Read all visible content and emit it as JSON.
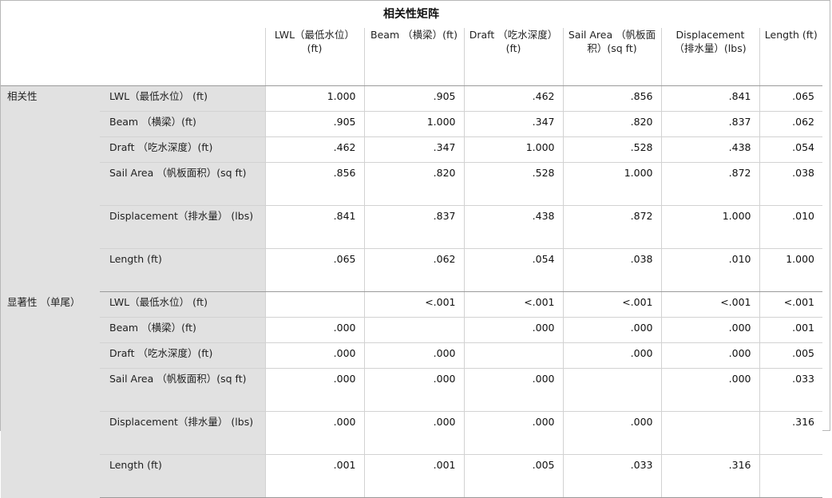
{
  "title": "相关性矩阵",
  "columns": [
    "LWL（最低水位）(ft)",
    "Beam （横梁）(ft)",
    "Draft （吃水深度）(ft)",
    "Sail Area （帆板面积）(sq ft)",
    "Displacement（排水量）(lbs)",
    "Length (ft)"
  ],
  "sections": [
    {
      "label": "相关性",
      "rows": [
        {
          "label": "LWL（最低水位） (ft)",
          "values": [
            "1.000",
            ".905",
            ".462",
            ".856",
            ".841",
            ".065"
          ]
        },
        {
          "label": "Beam （横梁）(ft)",
          "values": [
            ".905",
            "1.000",
            ".347",
            ".820",
            ".837",
            ".062"
          ]
        },
        {
          "label": "Draft （吃水深度）(ft)",
          "values": [
            ".462",
            ".347",
            "1.000",
            ".528",
            ".438",
            ".054"
          ]
        },
        {
          "label": "Sail Area （帆板面积）(sq ft)",
          "values": [
            ".856",
            ".820",
            ".528",
            "1.000",
            ".872",
            ".038"
          ]
        },
        {
          "label": "Displacement（排水量） (lbs)",
          "values": [
            ".841",
            ".837",
            ".438",
            ".872",
            "1.000",
            ".010"
          ]
        },
        {
          "label": "Length (ft)",
          "values": [
            ".065",
            ".062",
            ".054",
            ".038",
            ".010",
            "1.000"
          ]
        }
      ]
    },
    {
      "label": "显著性 （单尾）",
      "rows": [
        {
          "label": "LWL（最低水位） (ft)",
          "values": [
            "",
            "<.001",
            "<.001",
            "<.001",
            "<.001",
            "<.001"
          ]
        },
        {
          "label": "Beam （横梁）(ft)",
          "values": [
            ".000",
            "",
            ".000",
            ".000",
            ".000",
            ".001"
          ]
        },
        {
          "label": "Draft （吃水深度）(ft)",
          "values": [
            ".000",
            ".000",
            "",
            ".000",
            ".000",
            ".005"
          ]
        },
        {
          "label": "Sail Area （帆板面积）(sq ft)",
          "values": [
            ".000",
            ".000",
            ".000",
            "",
            ".000",
            ".033"
          ]
        },
        {
          "label": "Displacement（排水量） (lbs)",
          "values": [
            ".000",
            ".000",
            ".000",
            ".000",
            "",
            ".316"
          ]
        },
        {
          "label": "Length (ft)",
          "values": [
            ".001",
            ".001",
            ".005",
            ".033",
            ".316",
            ""
          ]
        }
      ]
    }
  ]
}
